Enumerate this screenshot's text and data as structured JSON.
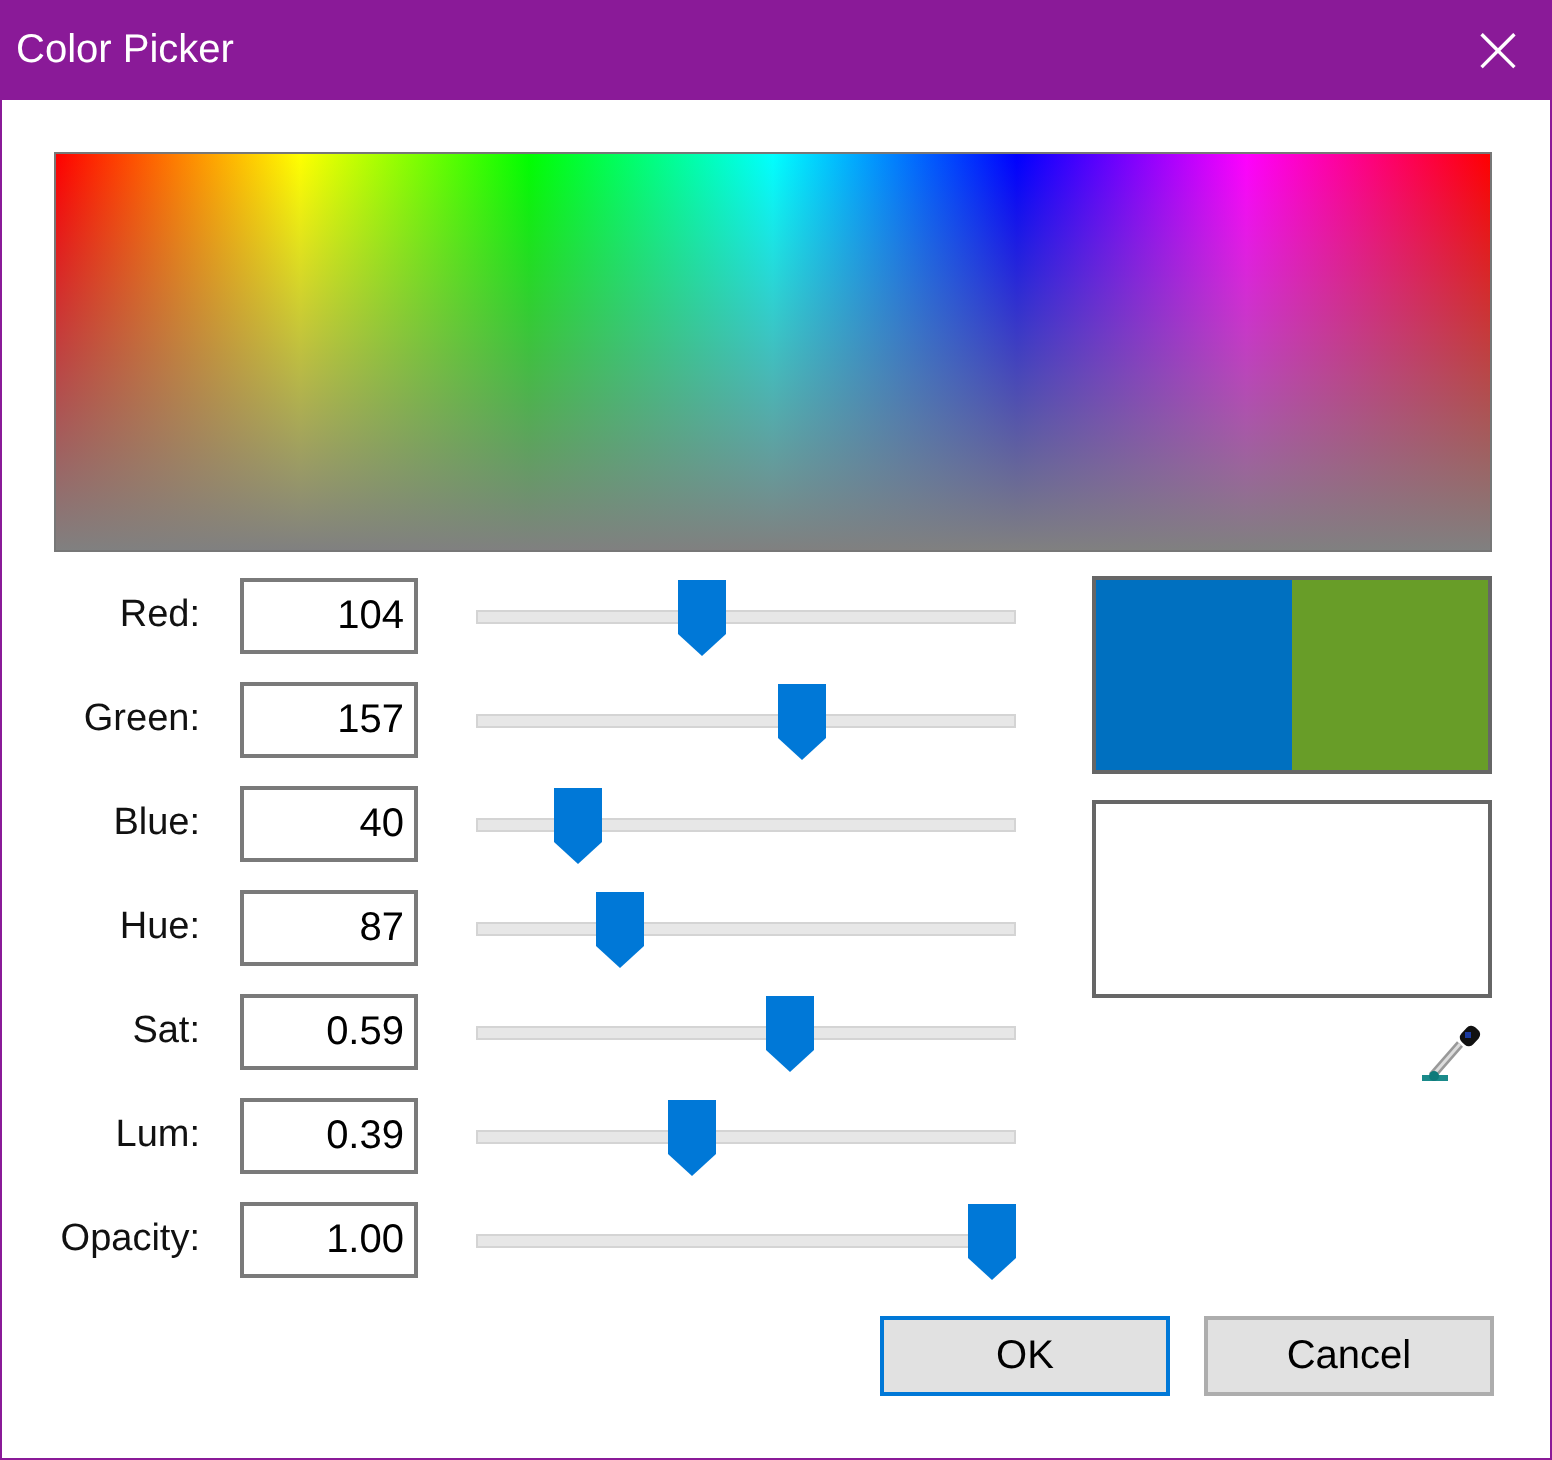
{
  "window": {
    "title": "Color Picker",
    "close": "×"
  },
  "channels": [
    {
      "label": "Red:",
      "value": "104",
      "level": 0.41
    },
    {
      "label": "Green:",
      "value": "157",
      "level": 0.615
    },
    {
      "label": "Blue:",
      "value": "40",
      "level": 0.157
    },
    {
      "label": "Hue:",
      "value": "87",
      "level": 0.242
    },
    {
      "label": "Sat:",
      "value": "0.59",
      "level": 0.59
    },
    {
      "label": "Lum:",
      "value": "0.39",
      "level": 0.39
    },
    {
      "label": "Opacity:",
      "value": "1.00",
      "level": 1.0
    }
  ],
  "swatches": [
    {
      "color": "#0070c0"
    },
    {
      "color": "#689d28"
    }
  ],
  "buttons": [
    {
      "label": "OK",
      "selected": true
    },
    {
      "label": "Cancel",
      "selected": false
    }
  ]
}
